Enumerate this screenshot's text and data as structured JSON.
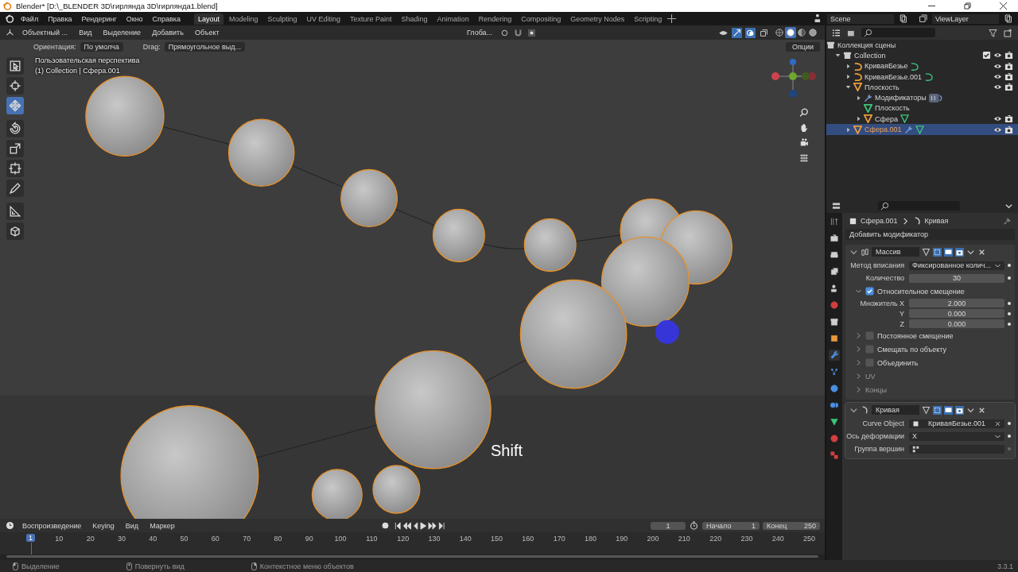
{
  "window": {
    "title": "Blender* [D:\\_BLENDER 3D\\гирлянда 3D\\гирлянда1.blend]"
  },
  "menu": [
    "Файл",
    "Правка",
    "Рендеринг",
    "Окно",
    "Справка"
  ],
  "workspaces": [
    {
      "label": "Layout",
      "selected": true
    },
    {
      "label": "Modeling",
      "selected": false
    },
    {
      "label": "Sculpting",
      "selected": false
    },
    {
      "label": "UV Editing",
      "selected": false
    },
    {
      "label": "Texture Paint",
      "selected": false
    },
    {
      "label": "Shading",
      "selected": false
    },
    {
      "label": "Animation",
      "selected": false
    },
    {
      "label": "Rendering",
      "selected": false
    },
    {
      "label": "Compositing",
      "selected": false
    },
    {
      "label": "Geometry Nodes",
      "selected": false
    },
    {
      "label": "Scripting",
      "selected": false
    }
  ],
  "scene": "Scene",
  "view_layer": "ViewLayer",
  "viewport": {
    "mode": "Объектный ...",
    "menus": [
      "Вид",
      "Выделение",
      "Добавить",
      "Объект"
    ],
    "transform_orientation": "Глоба...",
    "shading": [
      {
        "kind": "wireframe",
        "selected": false
      },
      {
        "kind": "solid",
        "selected": true
      },
      {
        "kind": "material",
        "selected": false
      },
      {
        "kind": "rendered",
        "selected": false
      }
    ],
    "tool_settings": {
      "orientation_label": "Ориентация:",
      "orientation": "По умолча",
      "drag_label": "Drag:",
      "drag": "Прямоугольное выд..."
    },
    "view_name": "Пользовательская перспектива",
    "collection_info": "(1) Collection | Сфера.001",
    "options": "Опции",
    "key_overlay": "Shift",
    "tools": [
      {
        "kind": "select",
        "selected": false
      },
      {
        "kind": "cursor",
        "selected": false
      },
      {
        "kind": "move",
        "selected": true
      },
      {
        "kind": "rotate",
        "selected": false
      },
      {
        "kind": "scale",
        "selected": false
      },
      {
        "kind": "transform",
        "selected": false
      },
      {
        "kind": "annotate",
        "selected": false
      },
      {
        "kind": "measure",
        "selected": false
      },
      {
        "kind": "add-cube",
        "selected": false
      }
    ]
  },
  "outliner": {
    "root": "Коллекция сцены",
    "items": [
      {
        "label": "Collection",
        "kind": "collection",
        "expanded": true,
        "selected": false,
        "checked": true,
        "children": [
          {
            "label": "КриваяБезье",
            "kind": "curve",
            "expanded": false,
            "selected": false
          },
          {
            "label": "КриваяБезье.001",
            "kind": "curve",
            "expanded": false,
            "selected": false
          },
          {
            "label": "Плоскость",
            "kind": "mesh",
            "expanded": true,
            "selected": false,
            "children": [
              {
                "label": "Модификаторы",
                "kind": "modifiers",
                "expanded": false,
                "selected": false
              },
              {
                "label": "Плоскость",
                "kind": "mesh-data",
                "selected": false
              },
              {
                "label": "Сфера",
                "kind": "mesh",
                "expanded": false,
                "selected": false
              }
            ]
          },
          {
            "label": "Сфера.001",
            "kind": "mesh",
            "expanded": false,
            "selected": true
          }
        ]
      }
    ]
  },
  "properties": {
    "tabs": [
      {
        "kind": "tool",
        "selected": false
      },
      {
        "kind": "render",
        "selected": false
      },
      {
        "kind": "output",
        "selected": false
      },
      {
        "kind": "view-layer",
        "selected": false
      },
      {
        "kind": "scene",
        "selected": false
      },
      {
        "kind": "world",
        "selected": false
      },
      {
        "kind": "collection",
        "selected": false
      },
      {
        "kind": "object",
        "selected": false
      },
      {
        "kind": "modifiers",
        "selected": true
      },
      {
        "kind": "particles",
        "selected": false
      },
      {
        "kind": "physics",
        "selected": false
      },
      {
        "kind": "constraints",
        "selected": false
      },
      {
        "kind": "data",
        "selected": false
      },
      {
        "kind": "material",
        "selected": false
      },
      {
        "kind": "texture",
        "selected": false
      }
    ],
    "breadcrumb": [
      "Сфера.001",
      "Кривая"
    ],
    "add_modifier": "Добавить модификатор",
    "modifiers": [
      {
        "kind": "array",
        "name": "Массив",
        "expanded": true,
        "rows": [
          {
            "kind": "dropdown",
            "label": "Метод вписания",
            "value": "Фиксированное колич..."
          },
          {
            "kind": "number",
            "label": "Количество",
            "value": "30"
          }
        ],
        "subpanels": [
          {
            "label": "Относительное смещение",
            "checked": true,
            "expanded": true,
            "rows": [
              {
                "label": "Множитель X",
                "value": "2.000"
              },
              {
                "label": "Y",
                "value": "0.000"
              },
              {
                "label": "Z",
                "value": "0.000"
              }
            ]
          },
          {
            "label": "Постоянное смещение",
            "checked": false,
            "expanded": false
          },
          {
            "label": "Смещать по объекту",
            "checked": false,
            "expanded": false
          },
          {
            "label": "Объединить",
            "checked": false,
            "expanded": false
          },
          {
            "label": "UV",
            "expanded": false
          },
          {
            "label": "Концы",
            "expanded": false
          }
        ]
      },
      {
        "kind": "curve",
        "name": "Кривая",
        "expanded": true,
        "rows": [
          {
            "kind": "object",
            "label": "Curve Object",
            "value": "КриваяБезье.001"
          },
          {
            "kind": "dropdown",
            "label": "Ось деформации",
            "value": "X"
          },
          {
            "kind": "vertex-group",
            "label": "Группа вершин"
          }
        ]
      }
    ]
  },
  "timeline": {
    "menus": [
      "Воспроизведение",
      "Keying",
      "Вид",
      "Маркер"
    ],
    "frame": "1",
    "start_label": "Начало",
    "start": "1",
    "end_label": "Конец",
    "end": "250",
    "current": "1",
    "ticks": [
      "10",
      "20",
      "30",
      "40",
      "50",
      "60",
      "70",
      "80",
      "90",
      "100",
      "110",
      "120",
      "130",
      "140",
      "150",
      "160",
      "170",
      "180",
      "190",
      "200",
      "210",
      "220",
      "230",
      "240",
      "250"
    ]
  },
  "status": {
    "hints": [
      {
        "kind": "mouse-left",
        "text": "Выделение"
      },
      {
        "kind": "mouse-middle",
        "text": "Повернуть вид"
      },
      {
        "kind": "mouse-right",
        "text": "Контекстное меню объектов"
      }
    ],
    "version": "3.3.1"
  }
}
